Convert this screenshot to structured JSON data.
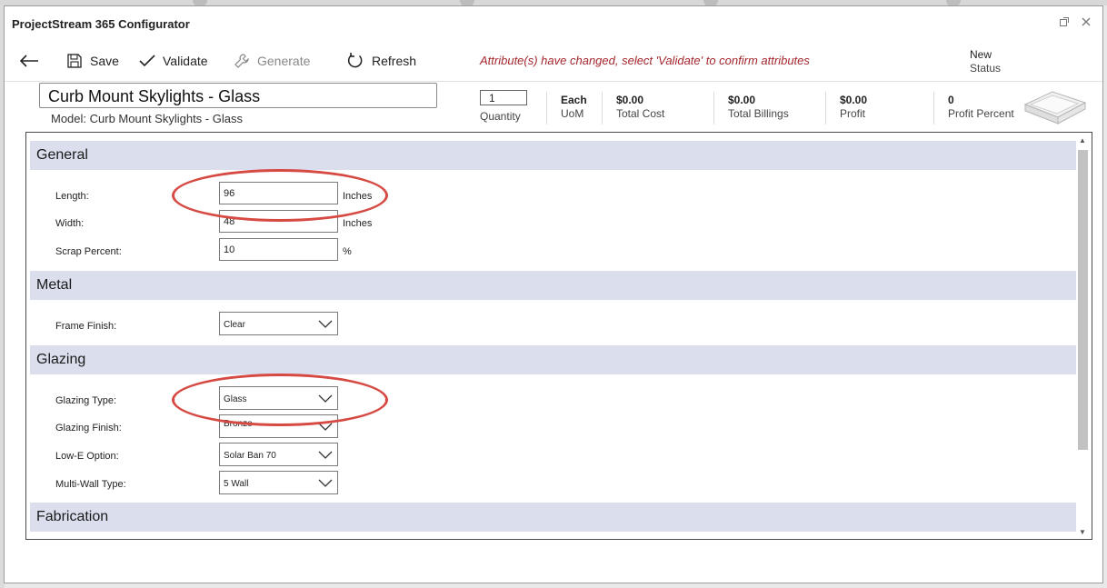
{
  "window": {
    "title": "ProjectStream 365 Configurator"
  },
  "toolbar": {
    "save_label": "Save",
    "validate_label": "Validate",
    "generate_label": "Generate",
    "refresh_label": "Refresh",
    "warning": "Attribute(s) have changed, select 'Validate' to confirm attributes",
    "status_value": "New",
    "status_label": "Status"
  },
  "header": {
    "name": "Curb Mount Skylights - Glass",
    "model": "Model: Curb Mount Skylights - Glass",
    "quantity_value": "1",
    "quantity_label": "Quantity",
    "uom_value": "Each",
    "uom_label": "UoM",
    "total_cost_value": "$0.00",
    "total_cost_label": "Total Cost",
    "total_billings_value": "$0.00",
    "total_billings_label": "Total Billings",
    "profit_value": "$0.00",
    "profit_label": "Profit",
    "profit_percent_value": "0",
    "profit_percent_label": "Profit Percent"
  },
  "sections": {
    "general": {
      "title": "General",
      "length": {
        "label": "Length:",
        "value": "96",
        "unit": "Inches"
      },
      "width": {
        "label": "Width:",
        "value": "48",
        "unit": "Inches"
      },
      "scrap": {
        "label": "Scrap Percent:",
        "value": "10",
        "unit": "%"
      }
    },
    "metal": {
      "title": "Metal",
      "frame_finish": {
        "label": "Frame Finish:",
        "value": "Clear"
      }
    },
    "glazing": {
      "title": "Glazing",
      "glazing_type": {
        "label": "Glazing Type:",
        "value": "Glass"
      },
      "glazing_finish": {
        "label": "Glazing Finish:",
        "value": "Bronze"
      },
      "low_e": {
        "label": "Low-E Option:",
        "value": "Solar Ban 70"
      },
      "multi_wall": {
        "label": "Multi-Wall Type:",
        "value": "5 Wall"
      }
    },
    "fabrication": {
      "title": "Fabrication"
    }
  },
  "colors": {
    "warning": "#a4262c",
    "section_bg": "#dbdfed",
    "highlight": "#d64a43"
  }
}
